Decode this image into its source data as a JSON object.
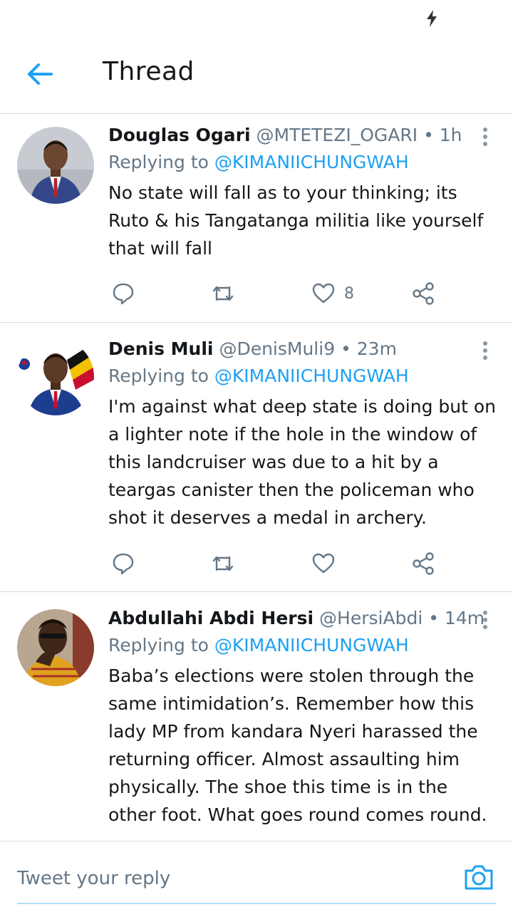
{
  "header": {
    "title": "Thread"
  },
  "tweets": [
    {
      "name": "Douglas Ogari",
      "handle": "@MTETEZI_OGARI",
      "separator": "•",
      "time": "1h",
      "replying_prefix": "Replying to",
      "replying_to": "@KIMANIICHUNGWAH",
      "text": "No state will fall as to your thinking; its Ruto & his Tangatanga militia like yourself that will fall",
      "like_count": "8"
    },
    {
      "name": "Denis Muli",
      "handle": "@DenisMuli9",
      "separator": "•",
      "time": "23m",
      "replying_prefix": "Replying to",
      "replying_to": "@KIMANIICHUNGWAH",
      "text": "I'm against what deep state is doing but on a lighter note if the hole in the window of this landcruiser was due to a hit by a teargas canister then the policeman who shot it deserves a medal in archery.",
      "like_count": ""
    },
    {
      "name": "Abdullahi Abdi Hersi",
      "handle": "@HersiAbdi",
      "separator": "•",
      "time": "14m",
      "replying_prefix": "Replying to",
      "replying_to": "@KIMANIICHUNGWAH",
      "text": "Baba’s elections were stolen through the same intimidation’s. Remember how this lady MP from kandara Nyeri harassed the returning officer. Almost assaulting him physically. The shoe this time is in the other foot. What goes round comes round."
    }
  ],
  "compose": {
    "placeholder": "Tweet your reply"
  },
  "colors": {
    "accent": "#1da1f2",
    "secondary_text": "#657786",
    "icon": "#657786",
    "divider": "#d9dde1"
  },
  "icons": {
    "status": "lightning-bolt-icon",
    "back": "arrow-left-icon",
    "more": "more-vertical-icon",
    "reply": "reply-bubble-icon",
    "retweet": "retweet-icon",
    "like": "heart-icon",
    "share": "share-icon",
    "camera": "camera-icon"
  }
}
